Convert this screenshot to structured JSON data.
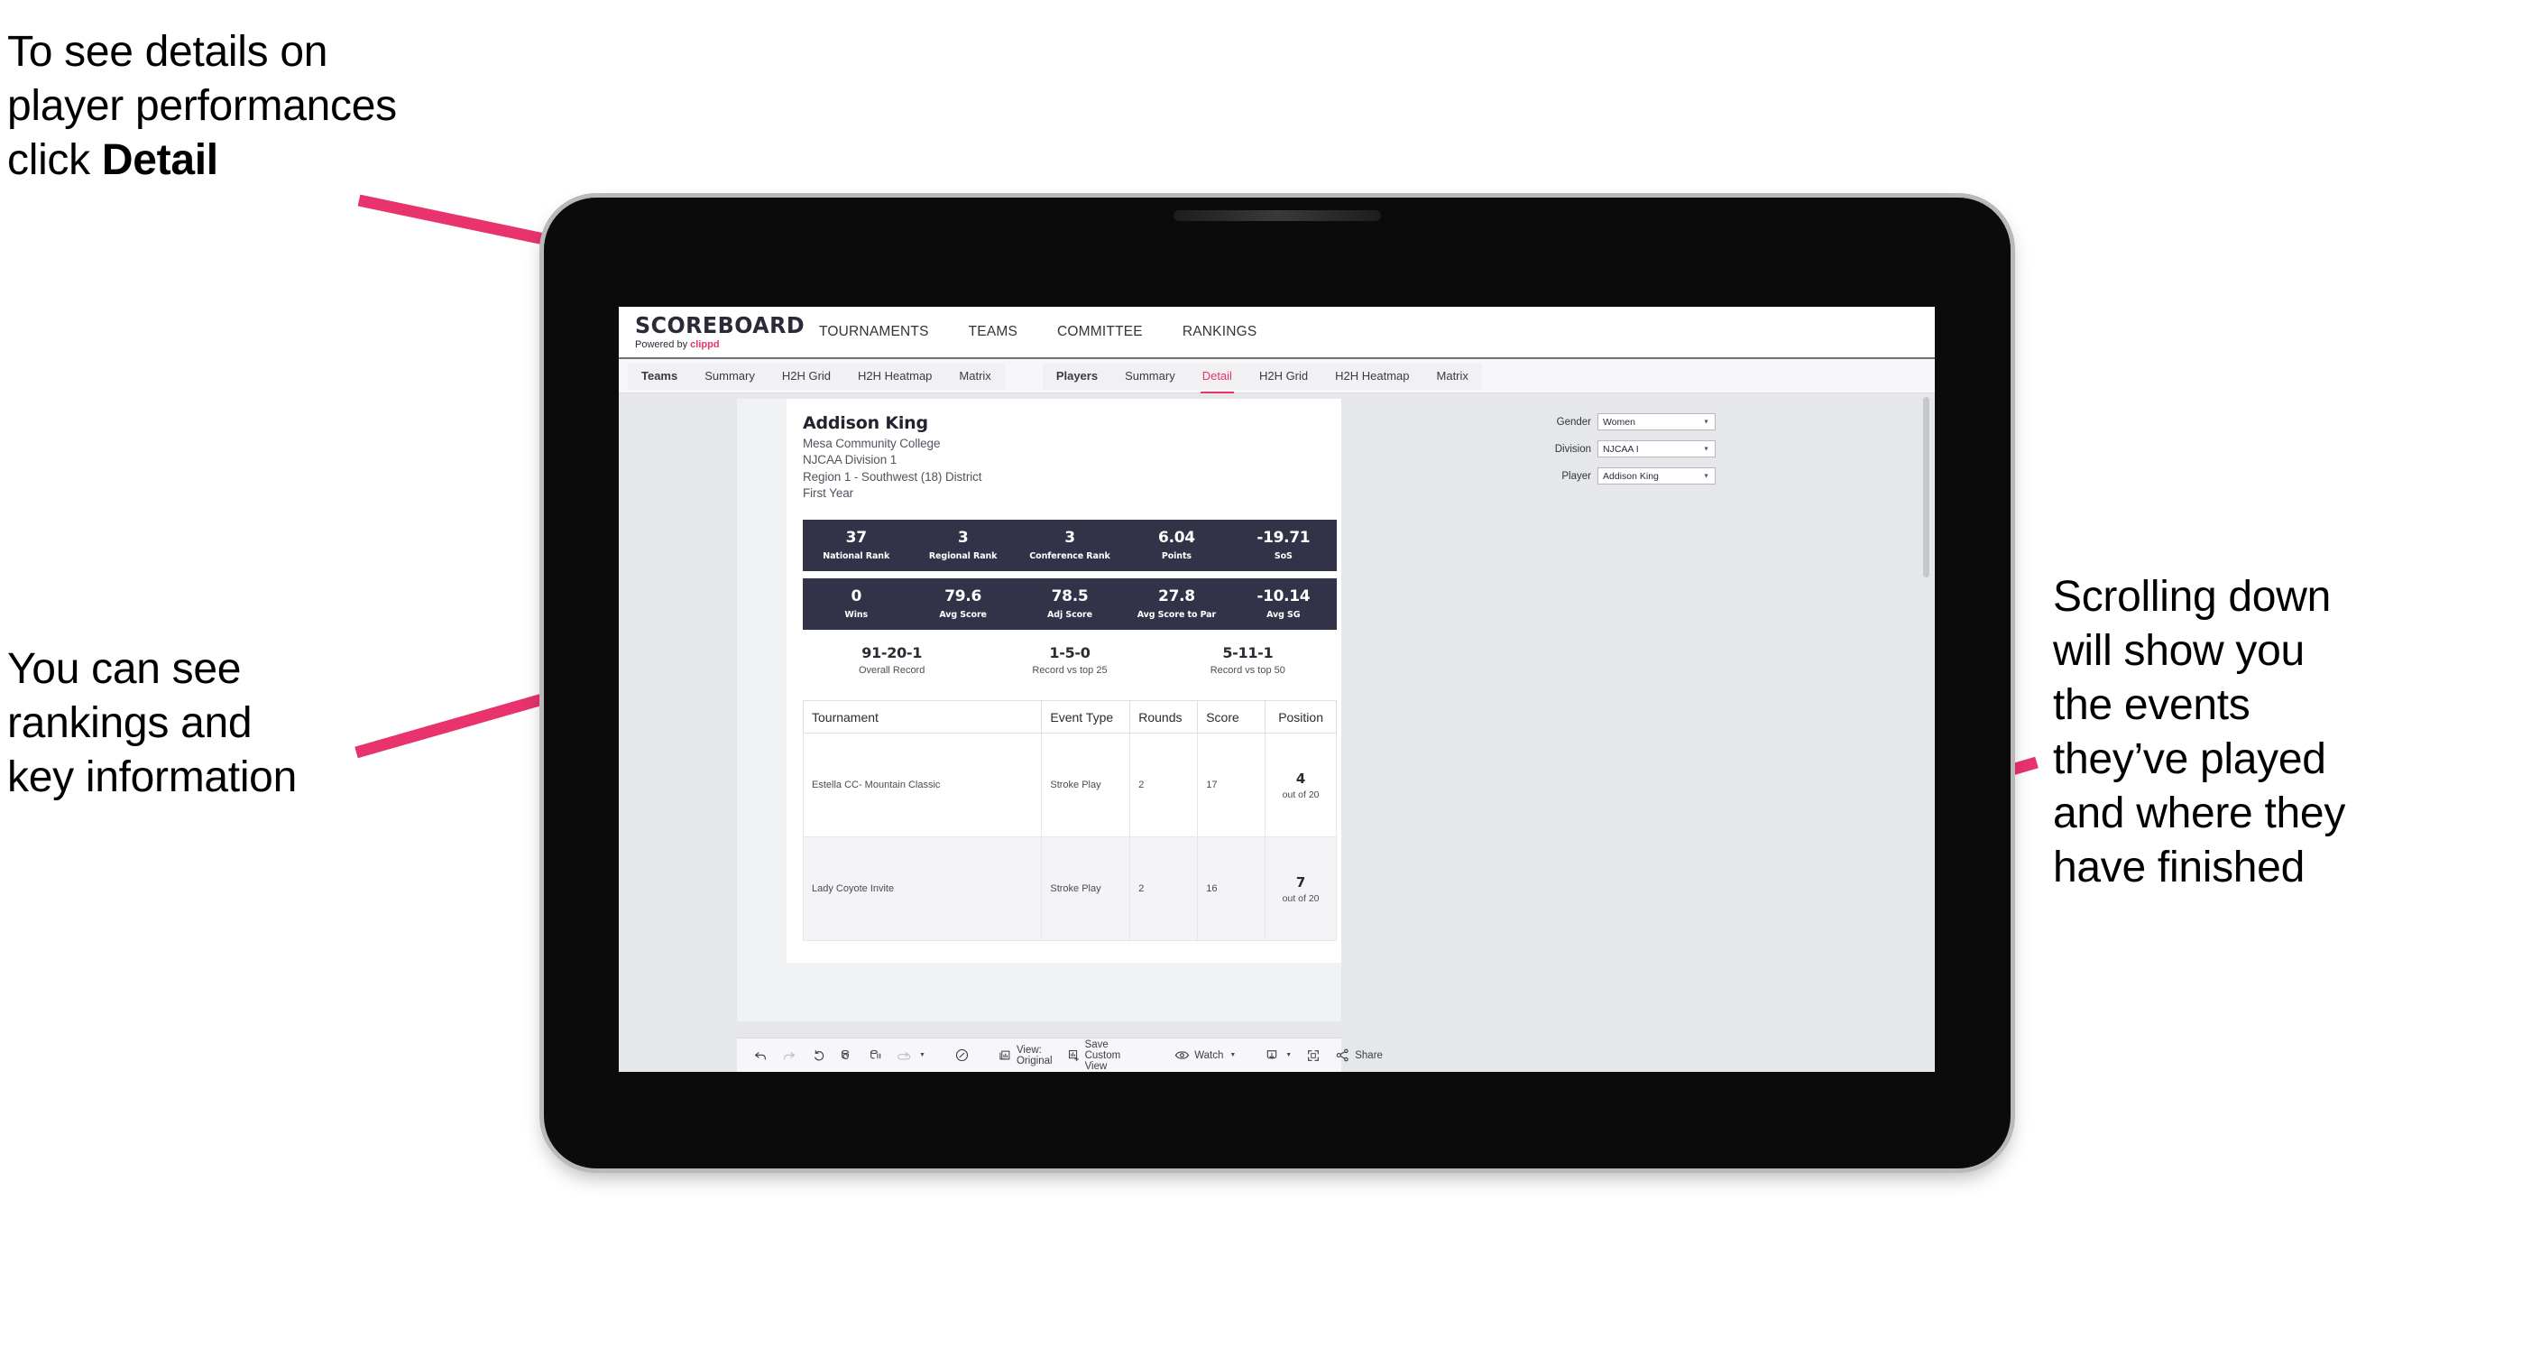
{
  "annotations": {
    "top_left": "To see details on\nplayer performances\nclick ",
    "top_left_bold": "Detail",
    "middle_left": "You can see\nrankings and\nkey information",
    "right": "Scrolling down\nwill show you\nthe events\nthey’ve played\nand where they\nhave finished"
  },
  "app": {
    "logo": {
      "word": "SCOREBOARD",
      "powered_prefix": "Powered by ",
      "brand": "clippd"
    },
    "top_nav": [
      {
        "label": "TOURNAMENTS"
      },
      {
        "label": "TEAMS"
      },
      {
        "label": "COMMITTEE"
      },
      {
        "label": "RANKINGS"
      }
    ],
    "subnav_teams": [
      {
        "label": "Teams",
        "strong": true
      },
      {
        "label": "Summary"
      },
      {
        "label": "H2H Grid"
      },
      {
        "label": "H2H Heatmap"
      },
      {
        "label": "Matrix"
      }
    ],
    "subnav_players": [
      {
        "label": "Players",
        "strong": true
      },
      {
        "label": "Summary"
      },
      {
        "label": "Detail",
        "active": true
      },
      {
        "label": "H2H Grid"
      },
      {
        "label": "H2H Heatmap"
      },
      {
        "label": "Matrix"
      }
    ]
  },
  "player": {
    "name": "Addison King",
    "school": "Mesa Community College",
    "division": "NJCAA Division 1",
    "region": "Region 1 - Southwest (18) District",
    "year": "First Year"
  },
  "filters": [
    {
      "label": "Gender",
      "value": "Women"
    },
    {
      "label": "Division",
      "value": "NJCAA I"
    },
    {
      "label": "Player",
      "value": "Addison King"
    }
  ],
  "kpis_row1": [
    {
      "value": "37",
      "label": "National Rank"
    },
    {
      "value": "3",
      "label": "Regional Rank"
    },
    {
      "value": "3",
      "label": "Conference Rank"
    },
    {
      "value": "6.04",
      "label": "Points"
    },
    {
      "value": "-19.71",
      "label": "SoS"
    }
  ],
  "kpis_row2": [
    {
      "value": "0",
      "label": "Wins"
    },
    {
      "value": "79.6",
      "label": "Avg Score"
    },
    {
      "value": "78.5",
      "label": "Adj Score"
    },
    {
      "value": "27.8",
      "label": "Avg Score to Par"
    },
    {
      "value": "-10.14",
      "label": "Avg SG"
    }
  ],
  "records": [
    {
      "value": "91-20-1",
      "label": "Overall Record"
    },
    {
      "value": "1-5-0",
      "label": "Record vs top 25"
    },
    {
      "value": "5-11-1",
      "label": "Record vs top 50"
    }
  ],
  "table": {
    "headers": [
      "Tournament",
      "Event Type",
      "Rounds",
      "Score",
      "Position"
    ],
    "rows": [
      {
        "tournament": "Estella CC- Mountain Classic",
        "event_type": "Stroke Play",
        "rounds": "2",
        "score": "17",
        "position": "4",
        "out_of": "out of 20"
      },
      {
        "tournament": "Lady Coyote Invite",
        "event_type": "Stroke Play",
        "rounds": "2",
        "score": "16",
        "position": "7",
        "out_of": "out of 20"
      }
    ]
  },
  "toolbar": {
    "view_label": "View: Original",
    "save_label": "Save Custom View",
    "watch_label": "Watch",
    "share_label": "Share"
  },
  "colors": {
    "accent": "#e8336d",
    "kpi_bar": "#323348",
    "arrow": "#e8336d"
  }
}
